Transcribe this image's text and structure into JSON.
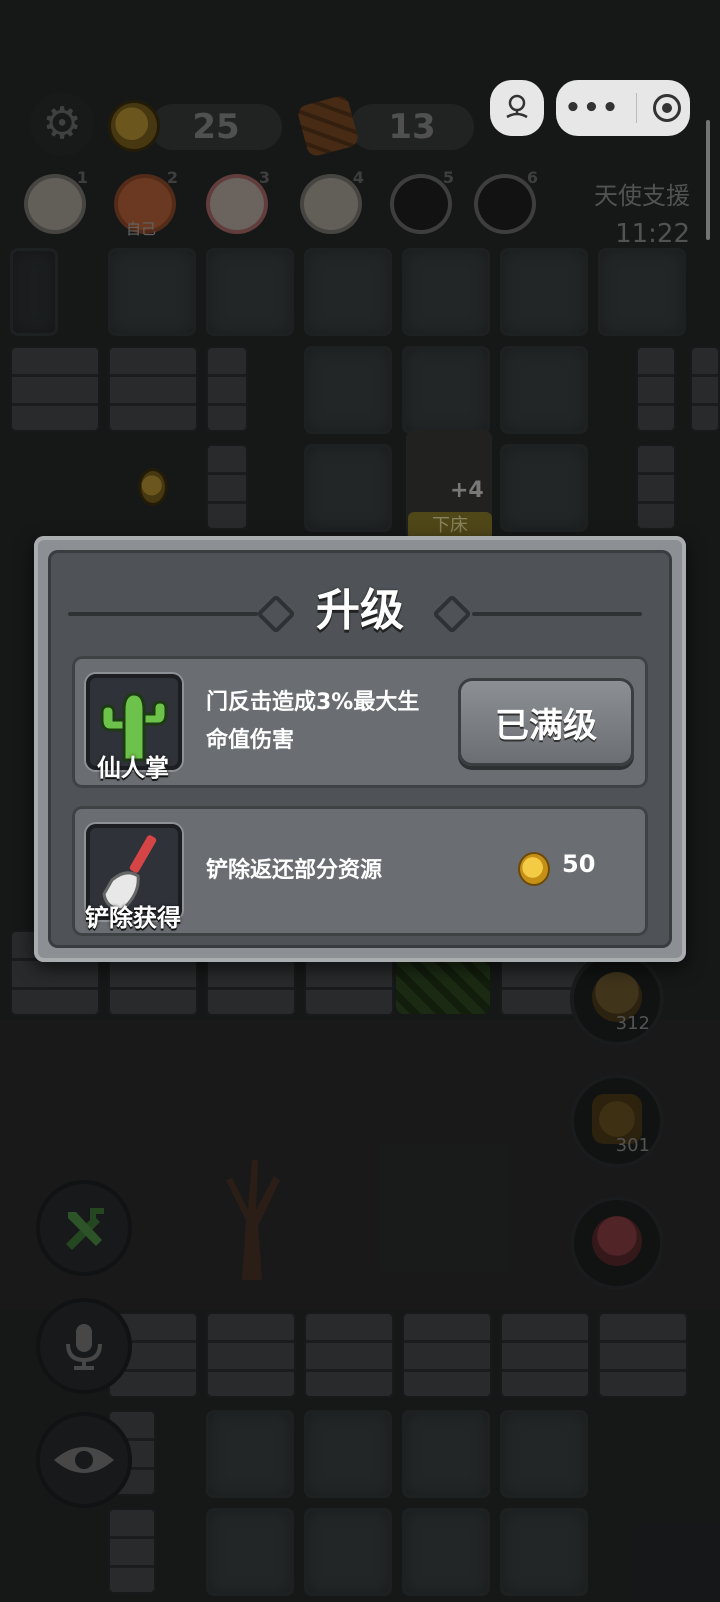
{
  "hud": {
    "gold": "25",
    "wood": "13",
    "support_label": "天使支援",
    "support_timer": "11:22"
  },
  "players": [
    {
      "num": "1",
      "tag": ""
    },
    {
      "num": "2",
      "tag": "自己"
    },
    {
      "num": "3",
      "tag": ""
    },
    {
      "num": "4",
      "tag": ""
    },
    {
      "num": "5",
      "tag": ""
    },
    {
      "num": "6",
      "tag": ""
    }
  ],
  "scene": {
    "bed_label": "下床",
    "bed_bonus": "+4"
  },
  "dialog": {
    "title": "升级",
    "items": [
      {
        "icon": "cactus-icon",
        "name": "仙人掌",
        "desc_line1": "门反击造成3%最大生",
        "desc_line2": "命值伤害",
        "button": "已满级"
      },
      {
        "icon": "shovel-icon",
        "name": "铲除获得",
        "desc_line1": "铲除返还部分资源",
        "cost": "50"
      }
    ]
  },
  "side_buttons": [
    {
      "icon": "poop-icon",
      "count": "312"
    },
    {
      "icon": "shield-icon",
      "count": "301"
    },
    {
      "icon": "ghost-icon",
      "count": ""
    }
  ],
  "left_buttons": [
    {
      "icon": "build-tools-icon"
    },
    {
      "icon": "microphone-icon"
    },
    {
      "icon": "eye-icon"
    }
  ]
}
